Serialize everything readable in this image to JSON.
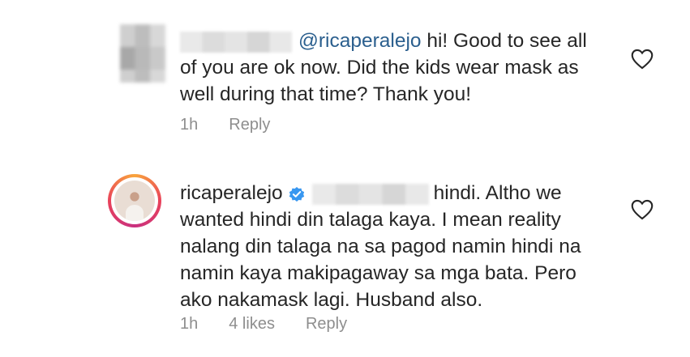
{
  "comments": [
    {
      "mention": "@ricaperalejo",
      "line1": " hi! Good to see all",
      "lines": [
        "of you are ok now. Did the kids wear mask as",
        "well during that time? Thank you!"
      ],
      "time": "1h",
      "reply": "Reply"
    },
    {
      "username": "ricaperalejo",
      "line1": "hindi. Altho we",
      "lines": [
        "wanted hindi din talaga kaya. I mean reality",
        "nalang din talaga na sa pagod namin hindi na",
        "namin kaya makipagaway sa mga bata. Pero",
        "ako nakamask lagi. Husband also."
      ],
      "time": "1h",
      "likes": "4 likes",
      "reply": "Reply"
    }
  ],
  "icons": {
    "heart": "heart-outline-icon",
    "verified": "verified-badge-icon"
  },
  "colors": {
    "mention": "#2b5f8e",
    "meta": "#8e8e8e",
    "verified": "#3897f0"
  }
}
